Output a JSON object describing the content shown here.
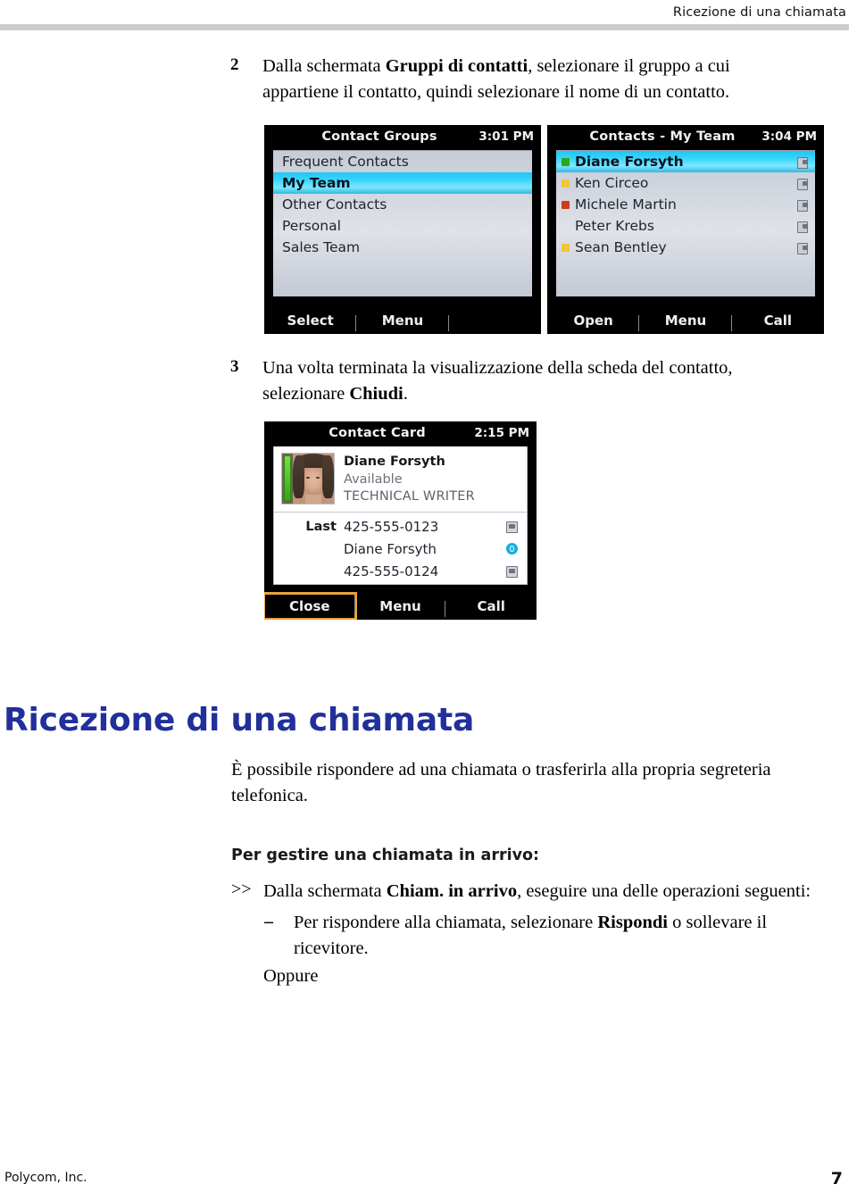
{
  "running_header": "Ricezione di una chiamata",
  "steps": [
    {
      "number": "2",
      "text_parts": [
        {
          "t": "Dalla schermata ",
          "b": false
        },
        {
          "t": "Gruppi di contatti",
          "b": true
        },
        {
          "t": ", selezionare il gruppo a cui appartiene il contatto, quindi selezionare il nome di un contatto.",
          "b": false
        }
      ]
    },
    {
      "number": "3",
      "text_parts": [
        {
          "t": "Una volta terminata la visualizzazione della scheda del contatto, selezionare ",
          "b": false
        },
        {
          "t": "Chiudi",
          "b": true
        },
        {
          "t": ".",
          "b": false
        }
      ]
    }
  ],
  "figures": {
    "contact_groups": {
      "title": "Contact Groups",
      "time": "3:01 PM",
      "items": [
        {
          "label": "Frequent Contacts",
          "selected": false
        },
        {
          "label": "My Team",
          "selected": true
        },
        {
          "label": "Other Contacts",
          "selected": false
        },
        {
          "label": "Personal",
          "selected": false
        },
        {
          "label": "Sales Team",
          "selected": false
        }
      ],
      "softkeys": [
        {
          "label": "Select",
          "highlight": false
        },
        {
          "label": "Menu",
          "highlight": false
        },
        {
          "label": "",
          "highlight": false
        }
      ]
    },
    "contacts_my_team": {
      "title": "Contacts - My Team",
      "time": "3:04 PM",
      "items": [
        {
          "name": "Diane Forsyth",
          "presence": "#2fa617",
          "selected": true
        },
        {
          "name": "Ken Circeo",
          "presence": "#f2c438",
          "selected": false
        },
        {
          "name": "Michele Martin",
          "presence": "#cf3a20",
          "selected": false
        },
        {
          "name": "Peter Krebs",
          "presence": "#dfe3ea",
          "selected": false
        },
        {
          "name": "Sean Bentley",
          "presence": "#f2c438",
          "selected": false
        }
      ],
      "softkeys": [
        {
          "label": "Open",
          "highlight": false
        },
        {
          "label": "Menu",
          "highlight": false
        },
        {
          "label": "Call",
          "highlight": false
        }
      ]
    },
    "contact_card": {
      "title": "Contact Card",
      "time": "2:15 PM",
      "contact_name": "Diane Forsyth",
      "contact_status": "Available",
      "contact_title": "TECHNICAL WRITER",
      "lines": [
        {
          "label": "Last",
          "value": "425-555-0123",
          "icon": "contact-card-icon"
        },
        {
          "label": "",
          "value": "Diane Forsyth",
          "icon": "instant-message-icon"
        },
        {
          "label": "",
          "value": "425-555-0124",
          "icon": "contact-card-icon"
        }
      ],
      "softkeys": [
        {
          "label": "Close",
          "highlight": true
        },
        {
          "label": "Menu",
          "highlight": false
        },
        {
          "label": "Call",
          "highlight": false
        }
      ]
    }
  },
  "chapter": {
    "heading": "Ricezione di una chiamata",
    "intro": "È possibile rispondere ad una chiamata o trasferirla alla propria segreteria telefonica.",
    "subheading": "Per gestire una chiamata in arrivo:",
    "bullet_marker": ">>",
    "bullet_parts": [
      {
        "t": "Dalla schermata ",
        "b": false
      },
      {
        "t": "Chiam. in arrivo",
        "b": true
      },
      {
        "t": ", eseguire una delle operazioni seguenti:",
        "b": false
      }
    ],
    "dash_marker": "–",
    "dash_parts": [
      {
        "t": "Per rispondere alla chiamata, selezionare ",
        "b": false
      },
      {
        "t": "Rispondi",
        "b": true
      },
      {
        "t": " o sollevare il ricevitore.",
        "b": false
      }
    ],
    "oppure": "Oppure"
  },
  "footer": {
    "left": "Polycom, Inc.",
    "right": "7"
  },
  "colors": {
    "heading_blue": "#21309a",
    "rule_gray": "#cdcdcd",
    "highlight_orange": "#e8a33d",
    "lcd_selection": "#35d6fb"
  }
}
